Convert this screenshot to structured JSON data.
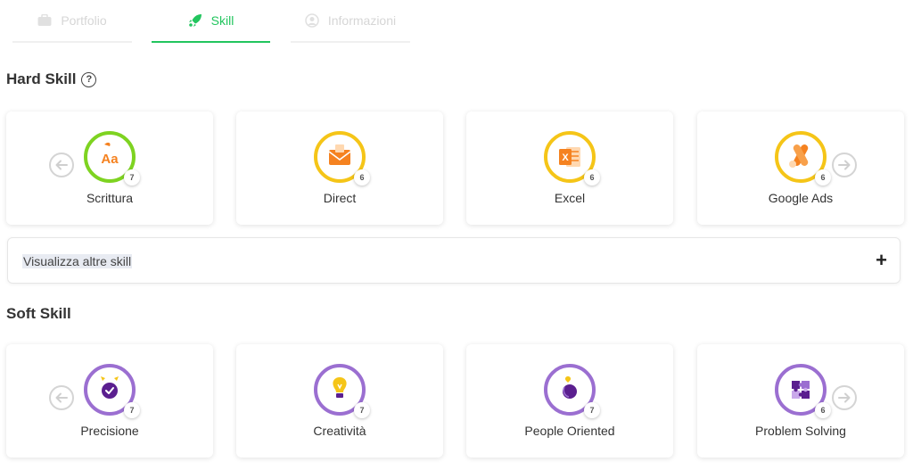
{
  "tabs": [
    {
      "label": "Portfolio",
      "icon": "briefcase-icon",
      "active": false
    },
    {
      "label": "Skill",
      "icon": "rocket-icon",
      "active": true
    },
    {
      "label": "Informazioni",
      "icon": "user-circle-icon",
      "active": false
    }
  ],
  "hard_skill": {
    "title": "Hard Skill",
    "help_glyph": "?",
    "cards": [
      {
        "label": "Scrittura",
        "level": "7",
        "icon": "font-aa-icon",
        "ring_color": "#7ed321"
      },
      {
        "label": "Direct",
        "level": "6",
        "icon": "envelope-icon",
        "ring_color": "#f5c518"
      },
      {
        "label": "Excel",
        "level": "6",
        "icon": "excel-icon",
        "ring_color": "#f5c518"
      },
      {
        "label": "Google Ads",
        "level": "6",
        "icon": "google-ads-icon",
        "ring_color": "#f5c518"
      }
    ]
  },
  "more": {
    "label": "Visualizza altre skill",
    "plus": "+"
  },
  "soft_skill": {
    "title": "Soft Skill",
    "cards": [
      {
        "label": "Precisione",
        "level": "7",
        "icon": "check-badge-icon",
        "ring_color": "#9b6fd1"
      },
      {
        "label": "Creatività",
        "level": "7",
        "icon": "lightbulb-icon",
        "ring_color": "#9b6fd1"
      },
      {
        "label": "People Oriented",
        "level": "7",
        "icon": "heart-hand-icon",
        "ring_color": "#9b6fd1"
      },
      {
        "label": "Problem Solving",
        "level": "6",
        "icon": "puzzle-icon",
        "ring_color": "#9b6fd1"
      }
    ]
  },
  "colors": {
    "accent": "#22c55e",
    "orange": "#f58220",
    "purple_dark": "#5b1f8f"
  }
}
